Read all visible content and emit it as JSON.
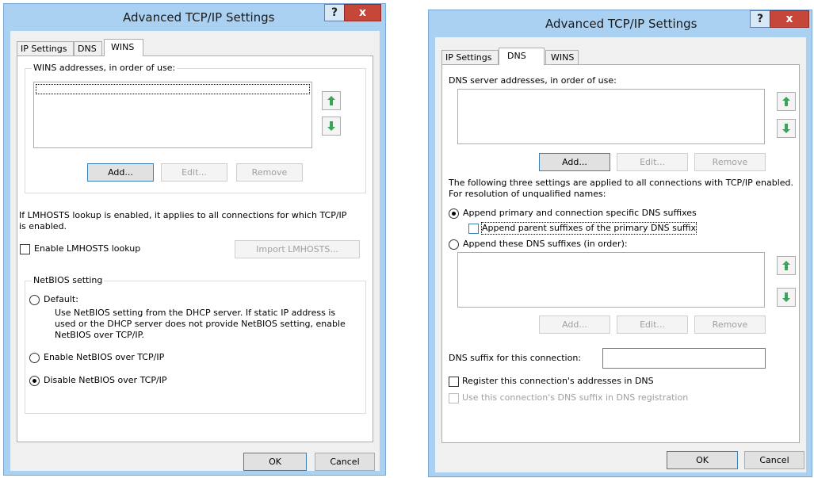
{
  "left": {
    "title": "Advanced TCP/IP Settings",
    "help_label": "?",
    "close_label": "x",
    "tabs": [
      {
        "label": "IP Settings"
      },
      {
        "label": "DNS"
      },
      {
        "label": "WINS"
      }
    ],
    "wins_group_label": "WINS addresses, in order of use:",
    "add_label": "Add...",
    "edit_label": "Edit...",
    "remove_label": "Remove",
    "lmhosts_info": "If LMHOSTS lookup is enabled, it applies to all connections for which TCP/IP is enabled.",
    "enable_lmhosts_label": "Enable LMHOSTS lookup",
    "enable_lmhosts_checked": false,
    "import_lmhosts_label": "Import LMHOSTS...",
    "netbios_group_label": "NetBIOS setting",
    "default_label": "Default:",
    "default_desc": "Use NetBIOS setting from the DHCP server. If static IP address is used or the DHCP server does not provide NetBIOS setting, enable NetBIOS over TCP/IP.",
    "enable_netbios_label": "Enable NetBIOS over TCP/IP",
    "disable_netbios_label": "Disable NetBIOS over TCP/IP",
    "selected_netbios": "disable",
    "ok_label": "OK",
    "cancel_label": "Cancel"
  },
  "right": {
    "title": "Advanced TCP/IP Settings",
    "help_label": "?",
    "close_label": "x",
    "tabs": [
      {
        "label": "IP Settings"
      },
      {
        "label": "DNS"
      },
      {
        "label": "WINS"
      }
    ],
    "dns_servers_label": "DNS server addresses, in order of use:",
    "add_label": "Add...",
    "edit_label": "Edit...",
    "remove_label": "Remove",
    "info": "The following three settings are applied to all connections with TCP/IP enabled. For resolution of unqualified names:",
    "append_primary_label": "Append primary and connection specific DNS suffixes",
    "append_parent_label": "Append parent suffixes of the primary DNS suffix",
    "append_these_label": "Append these DNS suffixes (in order):",
    "selected_append": "primary",
    "add2_label": "Add...",
    "edit2_label": "Edit...",
    "remove2_label": "Remove",
    "dns_suffix_label": "DNS suffix for this connection:",
    "dns_suffix_value": "",
    "register_label": "Register this connection's addresses in DNS",
    "use_suffix_label": "Use this connection's DNS suffix in DNS registration",
    "ok_label": "OK",
    "cancel_label": "Cancel"
  },
  "colors": {
    "frame": "#aad1f2",
    "close": "#c7463a",
    "arrow_green": "#3aa55a"
  },
  "icons": {
    "up": "move-up-arrow-icon",
    "down": "move-down-arrow-icon"
  }
}
